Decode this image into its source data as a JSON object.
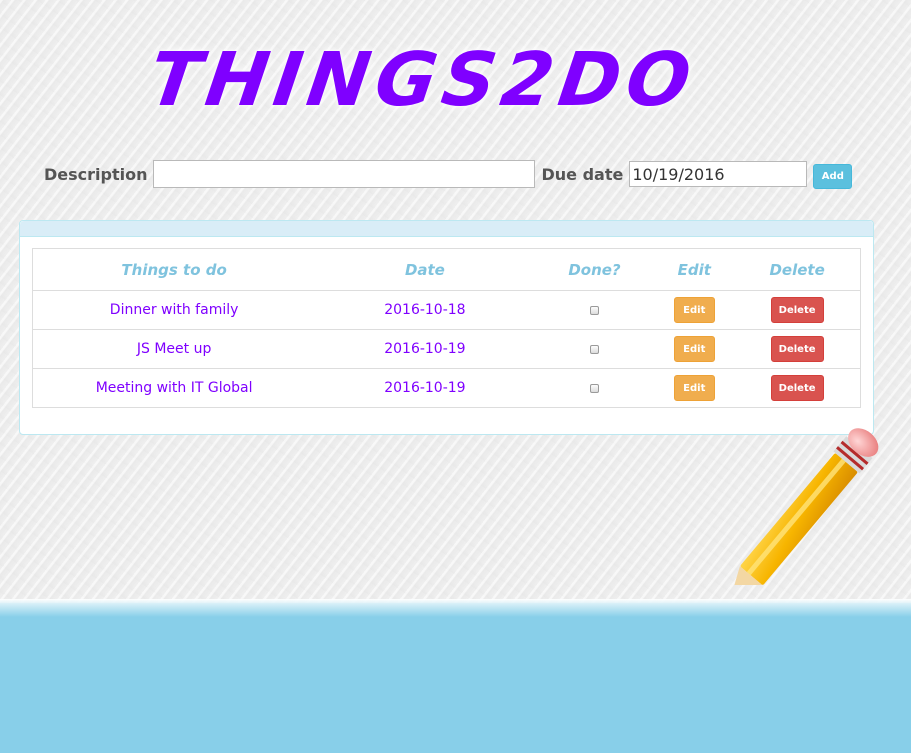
{
  "app": {
    "title": "THINGS2DO"
  },
  "form": {
    "description_label": "Description",
    "description_value": "",
    "due_date_label": "Due date",
    "due_date_value": "10/19/2016",
    "add_label": "Add"
  },
  "table": {
    "headers": {
      "task": "Things to do",
      "date": "Date",
      "done": "Done?",
      "edit": "Edit",
      "delete": "Delete"
    },
    "rows": [
      {
        "task": "Dinner with family",
        "date": "2016-10-18",
        "done": false,
        "edit_label": "Edit",
        "delete_label": "Delete"
      },
      {
        "task": "JS Meet up",
        "date": "2016-10-19",
        "done": false,
        "edit_label": "Edit",
        "delete_label": "Delete"
      },
      {
        "task": "Meeting with IT Global",
        "date": "2016-10-19",
        "done": false,
        "edit_label": "Edit",
        "delete_label": "Delete"
      }
    ]
  },
  "colors": {
    "title": "#7f00ff",
    "header_text": "#7fc3de",
    "row_text": "#7f00ff",
    "add_button": "#5bc0de",
    "edit_button": "#f0ad4e",
    "delete_button": "#d9534f",
    "bottom_band": "#88cfe9"
  },
  "decorations": {
    "pencil_icon": "pencil-icon"
  }
}
